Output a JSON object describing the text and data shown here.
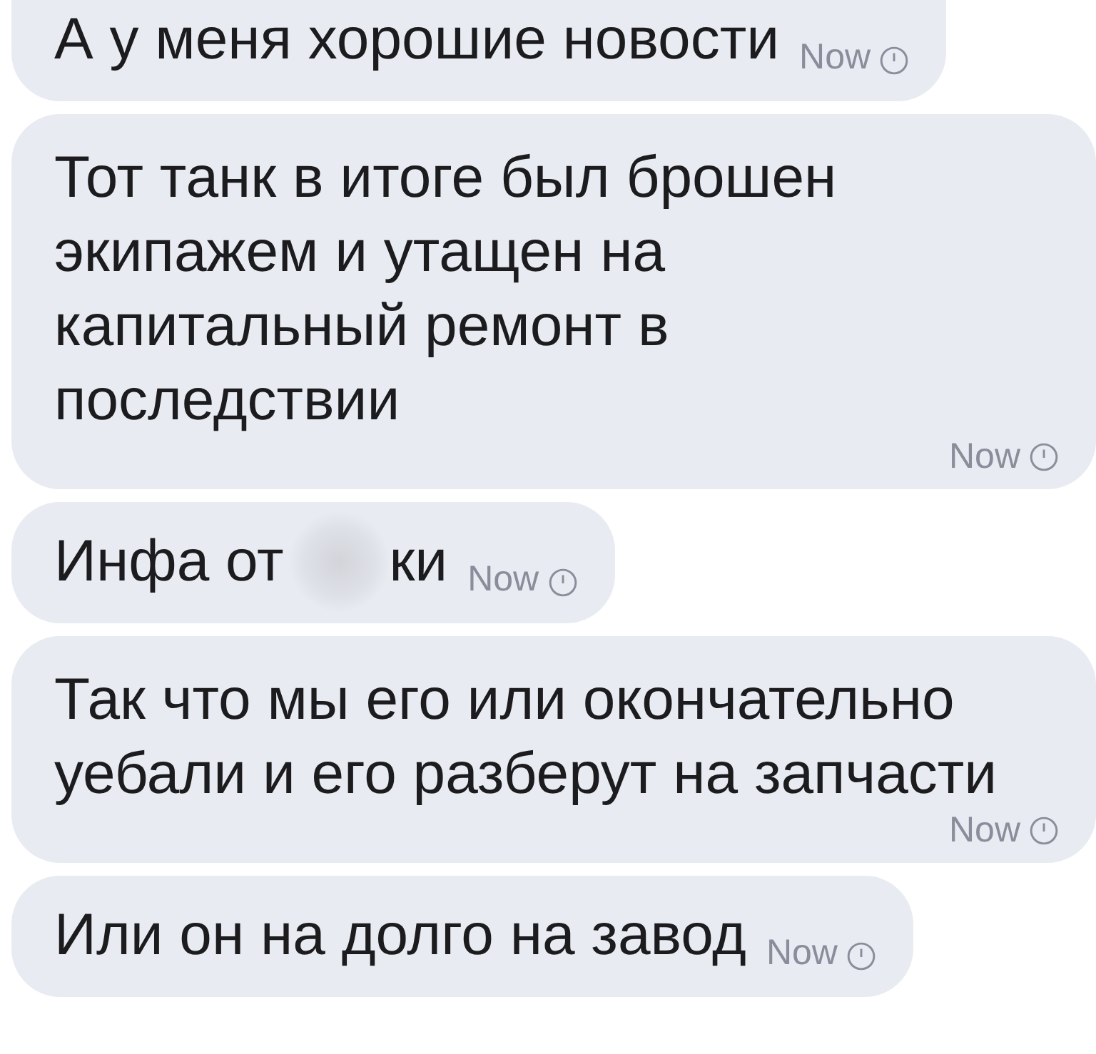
{
  "messages": [
    {
      "kind": "inline",
      "text": "А у меня хорошие новости",
      "time": "Now"
    },
    {
      "kind": "block",
      "text": "Тот танк в итоге был брошен экипажем и утащен на капитальный ремонт в последствии",
      "time": "Now"
    },
    {
      "kind": "inline",
      "text": "Инфа от",
      "redacted": true,
      "text_after": "ки",
      "time": "Now"
    },
    {
      "kind": "block",
      "text": "Так что мы его или окончательно уебали и его разберут на запчасти",
      "time": "Now"
    },
    {
      "kind": "inline",
      "text": "Или он на долго на завод",
      "time": "Now"
    }
  ]
}
